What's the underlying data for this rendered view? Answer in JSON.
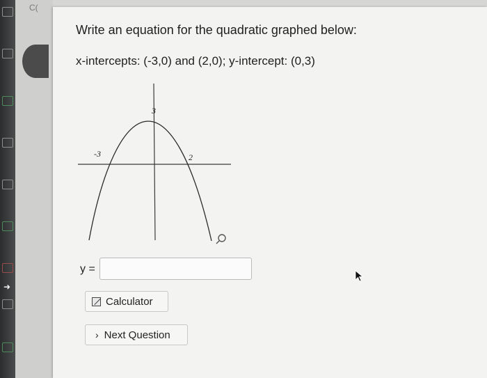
{
  "browser": {
    "tab_fragment": "C("
  },
  "question": {
    "title": "Write an equation for the quadratic graphed below:",
    "intercepts": "x-intercepts: (-3,0) and (2,0); y-intercept: (0,3)"
  },
  "graph": {
    "labels": {
      "y_intercept": "3",
      "x_left": "-3",
      "x_right": "2"
    },
    "icons": {
      "zoom": "magnifier-icon"
    }
  },
  "answer": {
    "label": "y =",
    "value": "",
    "placeholder": ""
  },
  "buttons": {
    "calculator": {
      "label": "Calculator",
      "icon": "calculator-icon"
    },
    "next": {
      "label": "Next Question",
      "icon": "chevron-right-icon"
    }
  }
}
